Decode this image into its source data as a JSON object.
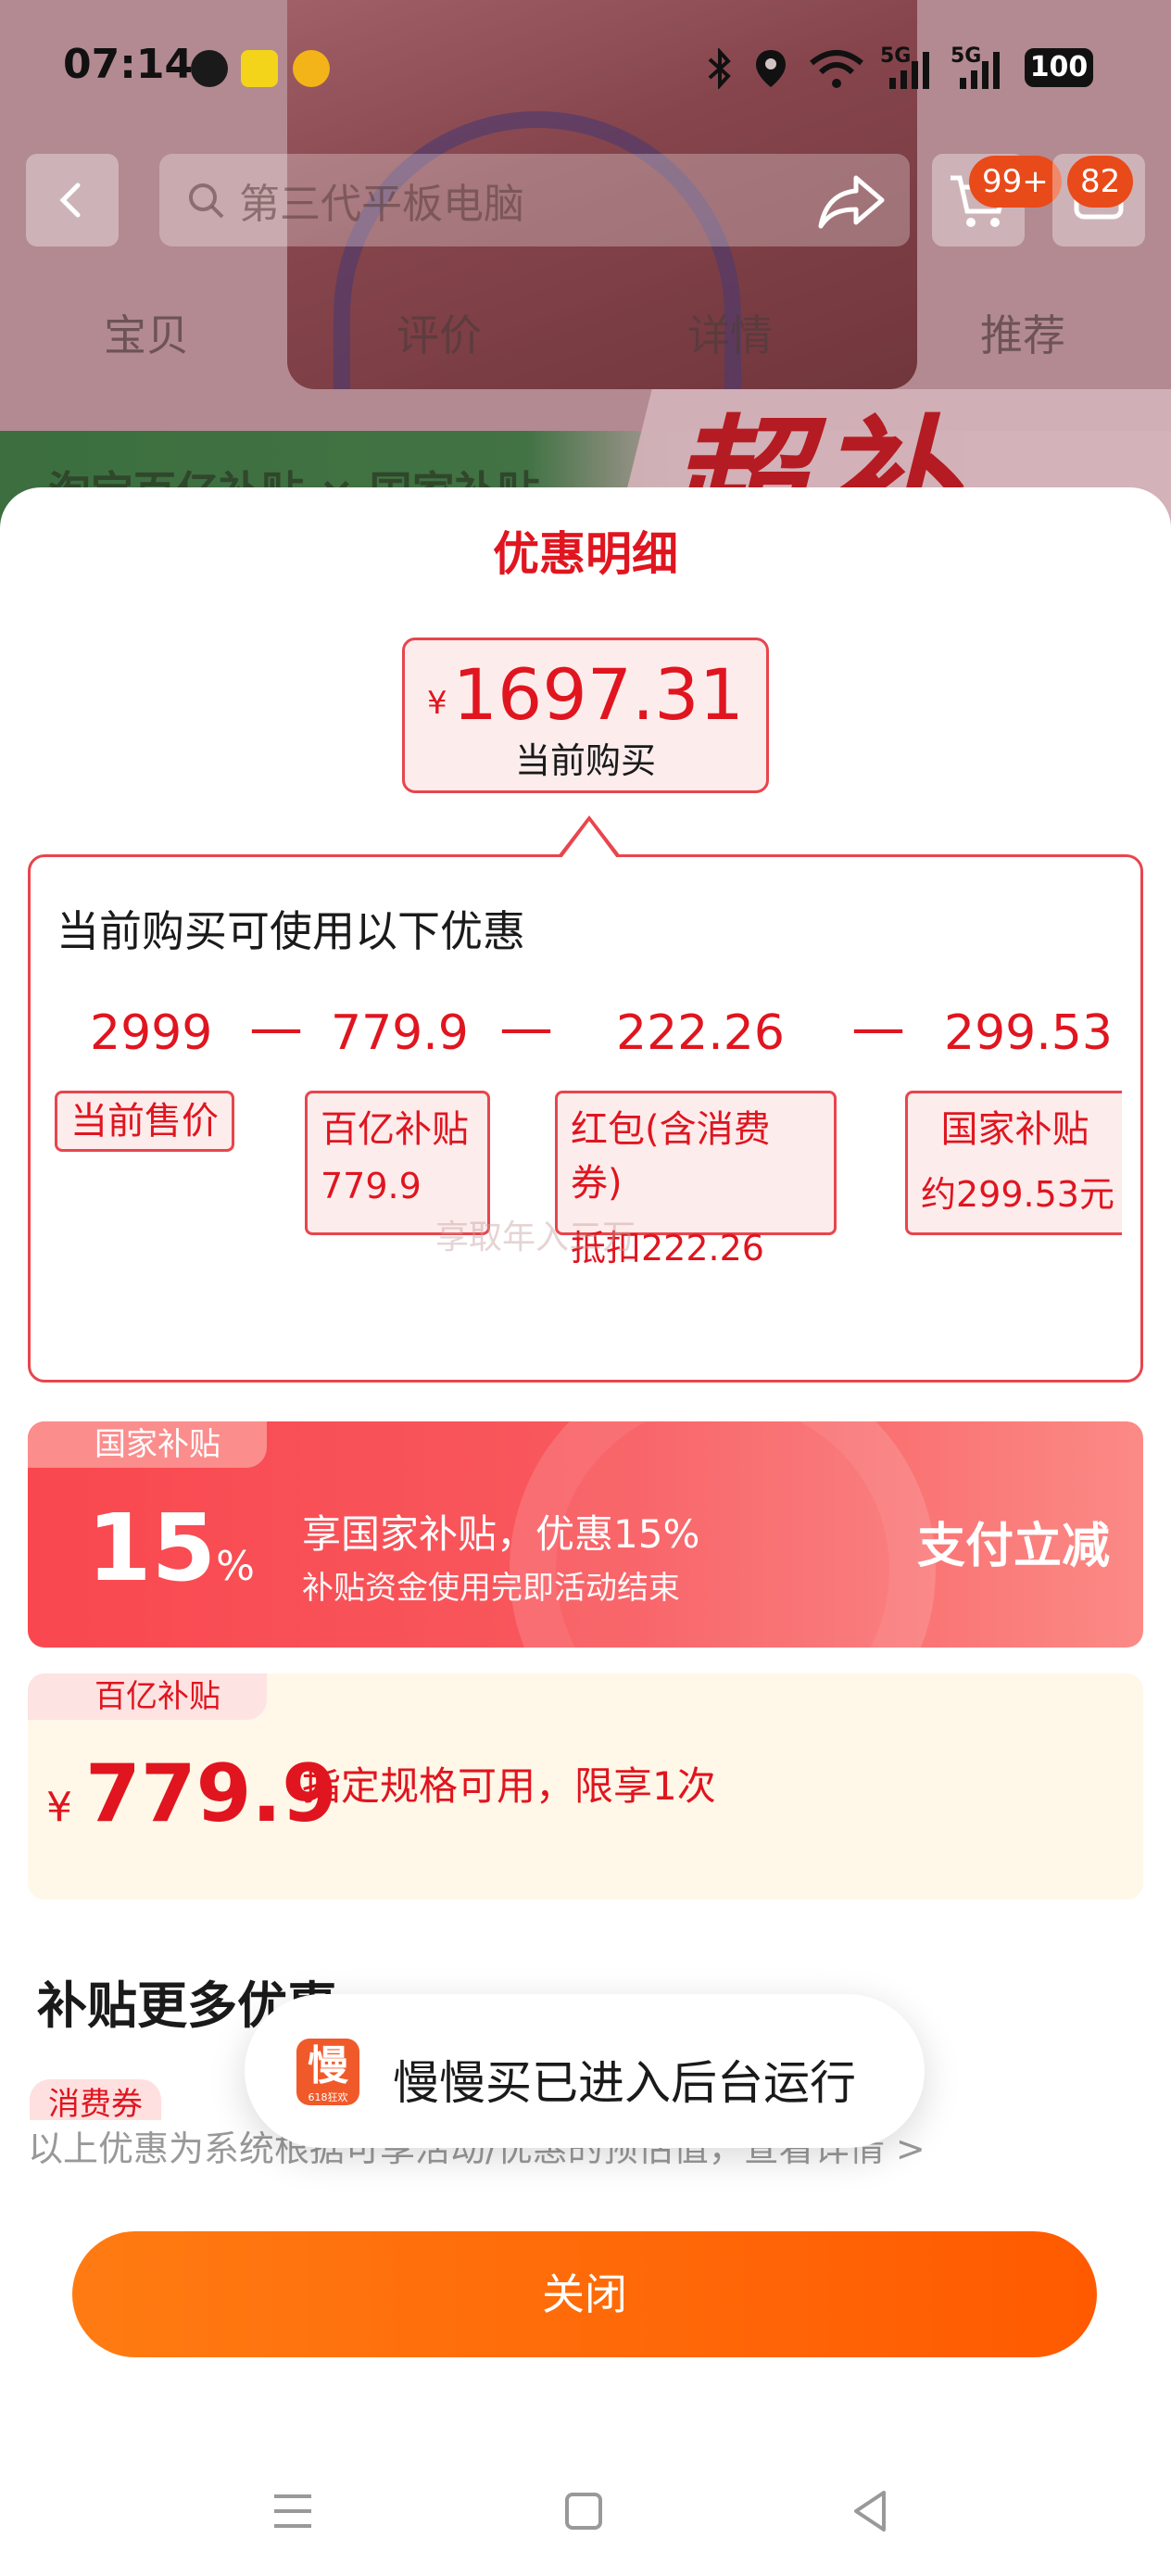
{
  "status_bar": {
    "time": "07:14",
    "battery": "100",
    "signal_labels": [
      "5G",
      "5G"
    ]
  },
  "nav": {
    "search_placeholder": "第三代平板电脑",
    "cart_badge": "99+",
    "message_badge": "82"
  },
  "tabs": [
    "宝贝",
    "评价",
    "详情",
    "推荐"
  ],
  "background": {
    "banner_text": "淘宝百亿补贴 × 国家补贴",
    "banner_big": "超补"
  },
  "sheet": {
    "title": "优惠明细",
    "price": {
      "currency": "¥",
      "amount": "1697.31",
      "label": "当前购买"
    },
    "detail": {
      "heading": "当前购买可使用以下优惠",
      "values": [
        "2999",
        "779.9",
        "222.26",
        "299.53"
      ],
      "operator": "—",
      "chips": [
        {
          "label": "当前售价",
          "sub": ""
        },
        {
          "label": "百亿补贴",
          "sub": "779.9"
        },
        {
          "label": "红包(含消费券)",
          "sub": "抵扣222.26"
        },
        {
          "label": "国家补贴",
          "sub": "约299.53元"
        }
      ],
      "watermark": "享取年入三万"
    },
    "gov_subsidy": {
      "tag": "国家补贴",
      "percent": "15",
      "percent_unit": "%",
      "title": "享国家补贴，优惠15%",
      "desc": "补贴资金使用完即活动结束",
      "action": "支付立减"
    },
    "bai_subsidy": {
      "tag": "百亿补贴",
      "currency": "¥",
      "amount": "779.9",
      "desc": "指定规格可用，限享1次"
    },
    "more_title": "补贴更多优惠",
    "more_chip": "消费券",
    "note": "以上优惠为系统根据可享活动/优惠的预估值，查看详情 >",
    "close_label": "关闭"
  },
  "toast": {
    "app_icon_text": "慢",
    "app_icon_sub": "618狂欢",
    "message": "慢慢买已进入后台运行"
  },
  "colors": {
    "accent_red": "#e0151f",
    "orange_button": "#ff6a0a",
    "gov_card": "#f9474f",
    "bai_card_bg": "#fff7e8"
  }
}
